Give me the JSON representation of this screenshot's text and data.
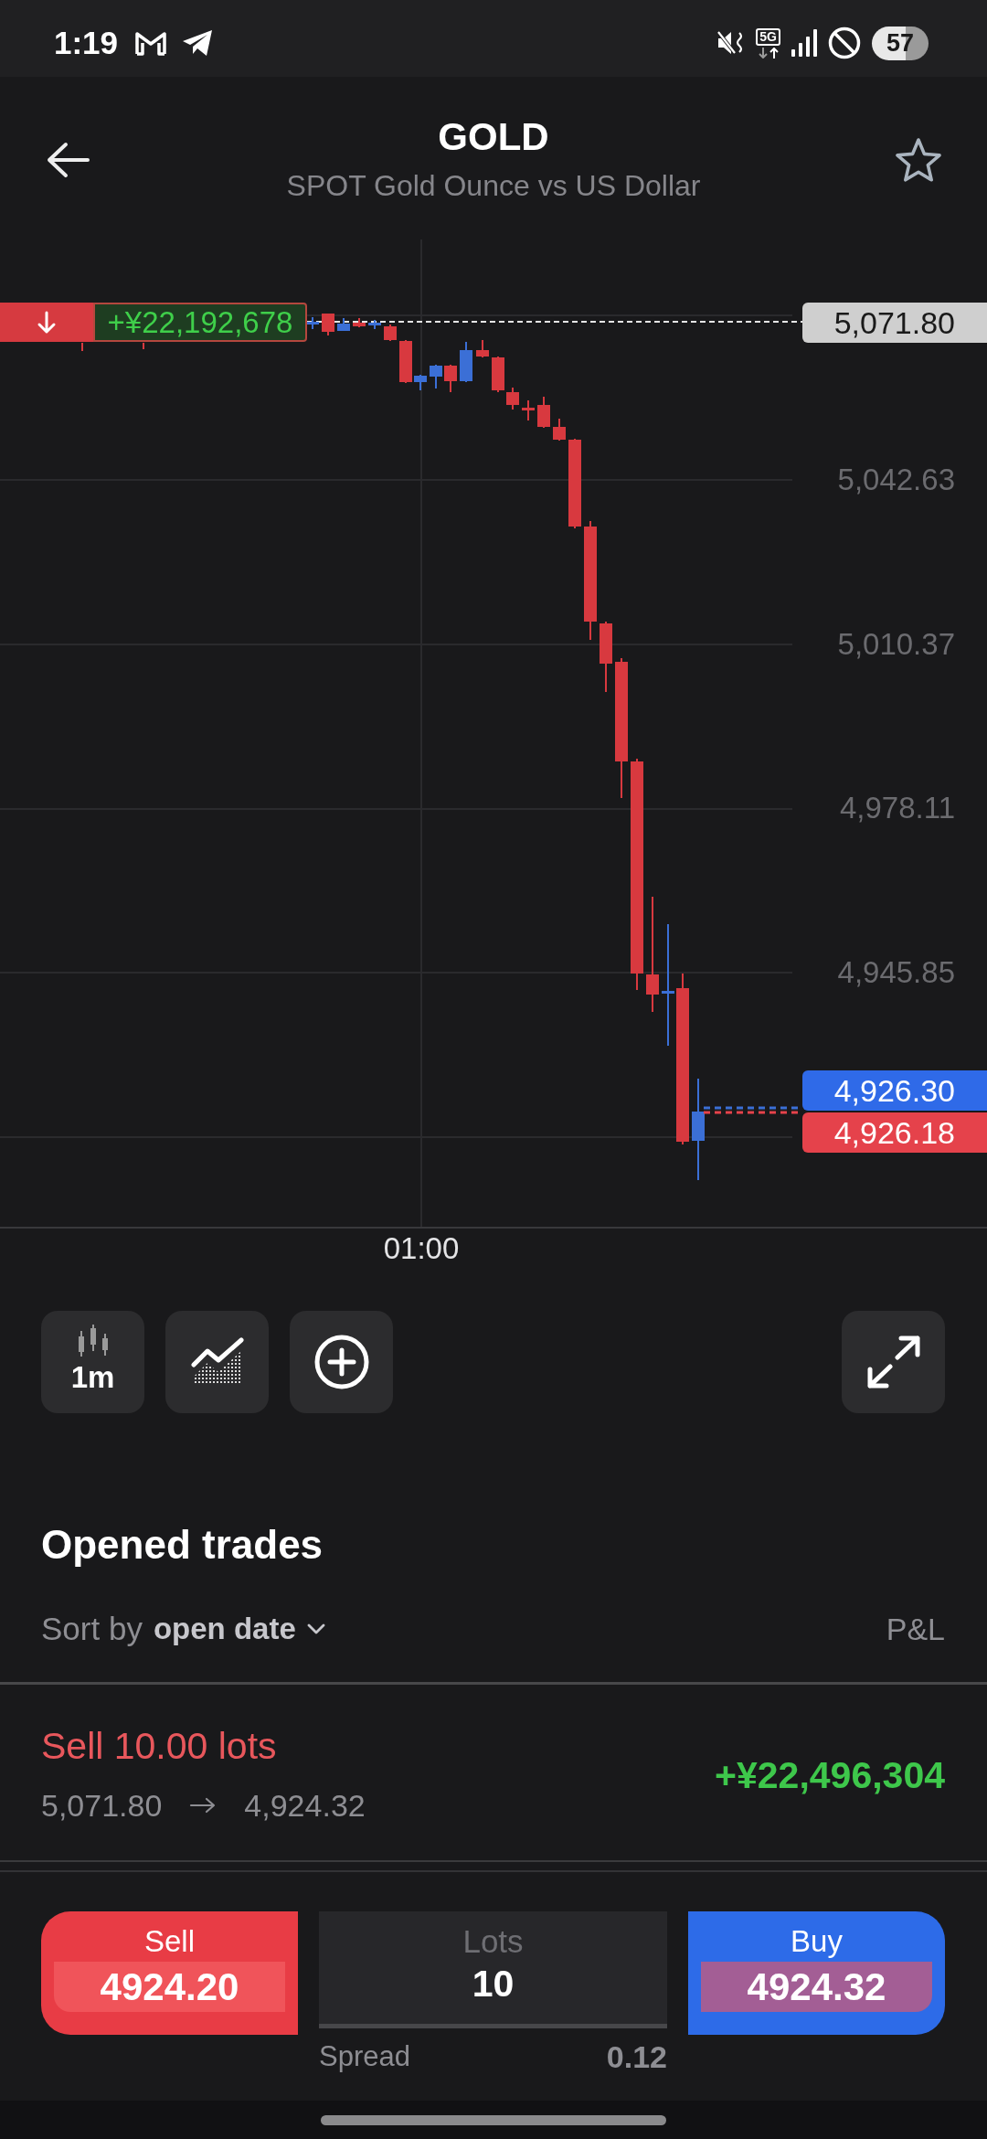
{
  "status_bar": {
    "time": "1:19",
    "network": "5G",
    "battery": "57"
  },
  "header": {
    "title": "GOLD",
    "subtitle": "SPOT Gold Ounce vs US Dollar",
    "favorite": false
  },
  "chart": {
    "position_pnl": "+¥22,192,678",
    "open_price": "5,071.80",
    "price_labels": [
      "5,042.63",
      "5,010.37",
      "4,978.11",
      "4,945.85"
    ],
    "ask_price": "4,926.30",
    "bid_price": "4,926.18",
    "time_label": "01:00"
  },
  "toolbar": {
    "timeframe": "1m"
  },
  "trades": {
    "title": "Opened trades",
    "sort_label": "Sort by",
    "sort_value": "open date",
    "pnl_header": "P&L",
    "rows": [
      {
        "kind": "sell",
        "label": "Sell 10.00 lots",
        "open_price": "5,071.80",
        "current_price": "4,924.32",
        "pnl": "+¥22,496,304"
      }
    ]
  },
  "order_panel": {
    "sell": {
      "label": "Sell",
      "price": "4924.20"
    },
    "lots": {
      "label": "Lots",
      "value": "10"
    },
    "buy": {
      "label": "Buy",
      "price": "4924.32"
    },
    "spread": {
      "label": "Spread",
      "value": "0.12"
    }
  }
}
